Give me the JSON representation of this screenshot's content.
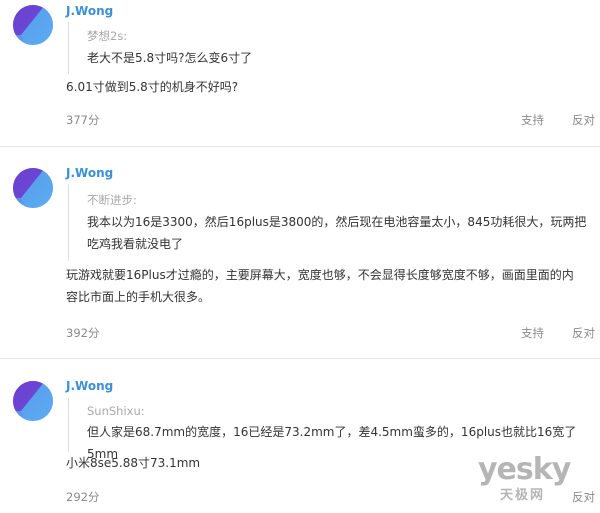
{
  "comments": [
    {
      "username": "J.Wong",
      "quote_author": "梦想2s:",
      "quote_lines": [
        "老大不是5.8寸吗?怎么变6寸了"
      ],
      "reply_lines": [
        "6.01寸做到5.8寸的机身不好吗?"
      ],
      "score": "377分",
      "support": "支持",
      "oppose": "反对"
    },
    {
      "username": "J.Wong",
      "quote_author": "不断进步:",
      "quote_lines": [
        "我本以为16是3300，然后16plus是3800的，然后现在电池容量太小，845功耗很大，玩两把",
        "吃鸡我看就没电了"
      ],
      "reply_lines": [
        "玩游戏就要16Plus才过瘾的，主要屏幕大，宽度也够，不会显得长度够宽度不够，画面里面的内",
        "容比市面上的手机大很多。"
      ],
      "score": "392分",
      "support": "支持",
      "oppose": "反对"
    },
    {
      "username": "J.Wong",
      "quote_author": "SunShixu:",
      "quote_lines": [
        "但人家是68.7mm的宽度，16已经是73.2mm了，差4.5mm蛮多的，16plus也就比16宽了5mm"
      ],
      "reply_lines": [
        "小米8se5.88寸73.1mm"
      ],
      "score": "292分",
      "support": "支持",
      "oppose": "反对"
    }
  ],
  "watermark": {
    "brand": "yesky",
    "cn": "天极网"
  }
}
